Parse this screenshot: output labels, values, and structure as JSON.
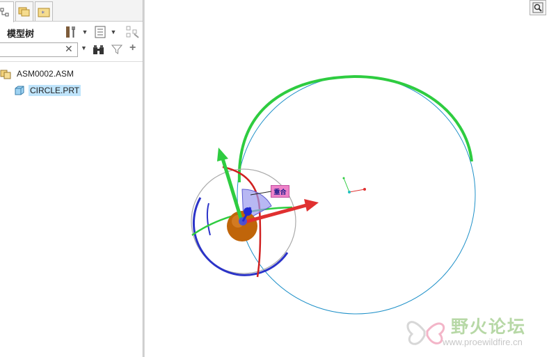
{
  "model_tree": {
    "title": "模型树",
    "search": {
      "value": "",
      "placeholder": ""
    },
    "items": [
      {
        "label": "ASM0002.ASM",
        "type": "assembly"
      },
      {
        "label": "CIRCLE.PRT",
        "type": "part",
        "selected": true
      }
    ]
  },
  "viewport": {
    "constraint_tag": "重合"
  },
  "watermark": {
    "title": "野火论坛",
    "url": "www.proewildfire.cn"
  },
  "colors": {
    "tree_selected": "#bfe4fb",
    "axis_green": "#2ecc40",
    "axis_red": "#e03030",
    "axis_blue": "#2b33c8",
    "tag_pink": "#ee82c8"
  }
}
